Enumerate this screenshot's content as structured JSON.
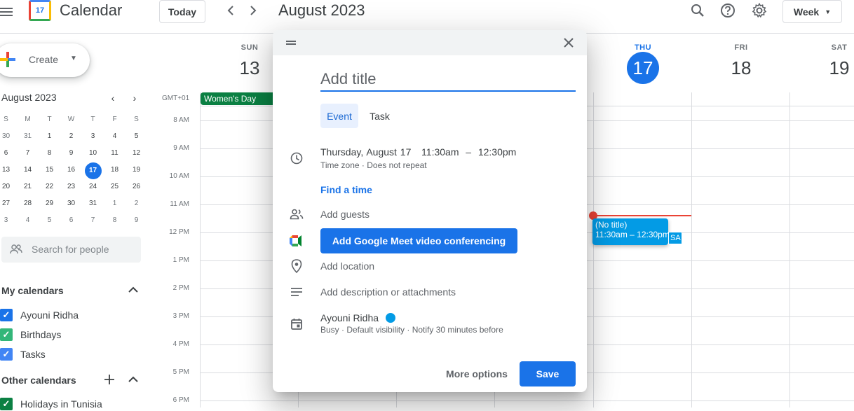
{
  "header": {
    "logo_day": "17",
    "app_title": "Calendar",
    "today_label": "Today",
    "month_title": "August 2023",
    "view_label": "Week"
  },
  "sidebar": {
    "create_label": "Create",
    "mini_title": "August 2023",
    "mini_dow": [
      "S",
      "M",
      "T",
      "W",
      "T",
      "F",
      "S"
    ],
    "mini_weeks": [
      [
        "30",
        "31",
        "1",
        "2",
        "3",
        "4",
        "5"
      ],
      [
        "6",
        "7",
        "8",
        "9",
        "10",
        "11",
        "12"
      ],
      [
        "13",
        "14",
        "15",
        "16",
        "17",
        "18",
        "19"
      ],
      [
        "20",
        "21",
        "22",
        "23",
        "24",
        "25",
        "26"
      ],
      [
        "27",
        "28",
        "29",
        "30",
        "31",
        "1",
        "2"
      ],
      [
        "3",
        "4",
        "5",
        "6",
        "7",
        "8",
        "9"
      ]
    ],
    "search_people_placeholder": "Search for people",
    "my_calendars_title": "My calendars",
    "my_calendars": [
      {
        "label": "Ayouni Ridha",
        "color": "#1a73e8"
      },
      {
        "label": "Birthdays",
        "color": "#33b679"
      },
      {
        "label": "Tasks",
        "color": "#4285f4"
      }
    ],
    "other_calendars_title": "Other calendars",
    "other_calendars": [
      {
        "label": "Holidays in Tunisia",
        "color": "#0b8043"
      }
    ]
  },
  "grid": {
    "days": [
      {
        "dow": "SUN",
        "num": "13"
      },
      {
        "dow": "THU",
        "num": "17"
      },
      {
        "dow": "FRI",
        "num": "18"
      },
      {
        "dow": "SAT",
        "num": "19"
      }
    ],
    "timezone": "GMT+01",
    "hours": [
      "8 AM",
      "9 AM",
      "10 AM",
      "11 AM",
      "12 PM",
      "1 PM",
      "2 PM",
      "3 PM",
      "4 PM",
      "5 PM",
      "6 PM"
    ],
    "allday_event": "Women's Day",
    "event_title": "(No title)",
    "event_time": "11:30am – 12:30pm",
    "event_small": "SA"
  },
  "dialog": {
    "title_placeholder": "Add title",
    "tab_event": "Event",
    "tab_task": "Task",
    "date_text": "Thursday, August 17   11:30am  –  12:30pm",
    "date_sub": "Time zone · Does not repeat",
    "find_time": "Find a time",
    "add_guests": "Add guests",
    "meet_label": "Add Google Meet video conferencing",
    "add_location": "Add location",
    "add_description": "Add description or attachments",
    "owner_name": "Ayouni Ridha",
    "owner_sub": "Busy · Default visibility · Notify 30 minutes before",
    "more_options": "More options",
    "save_label": "Save"
  }
}
